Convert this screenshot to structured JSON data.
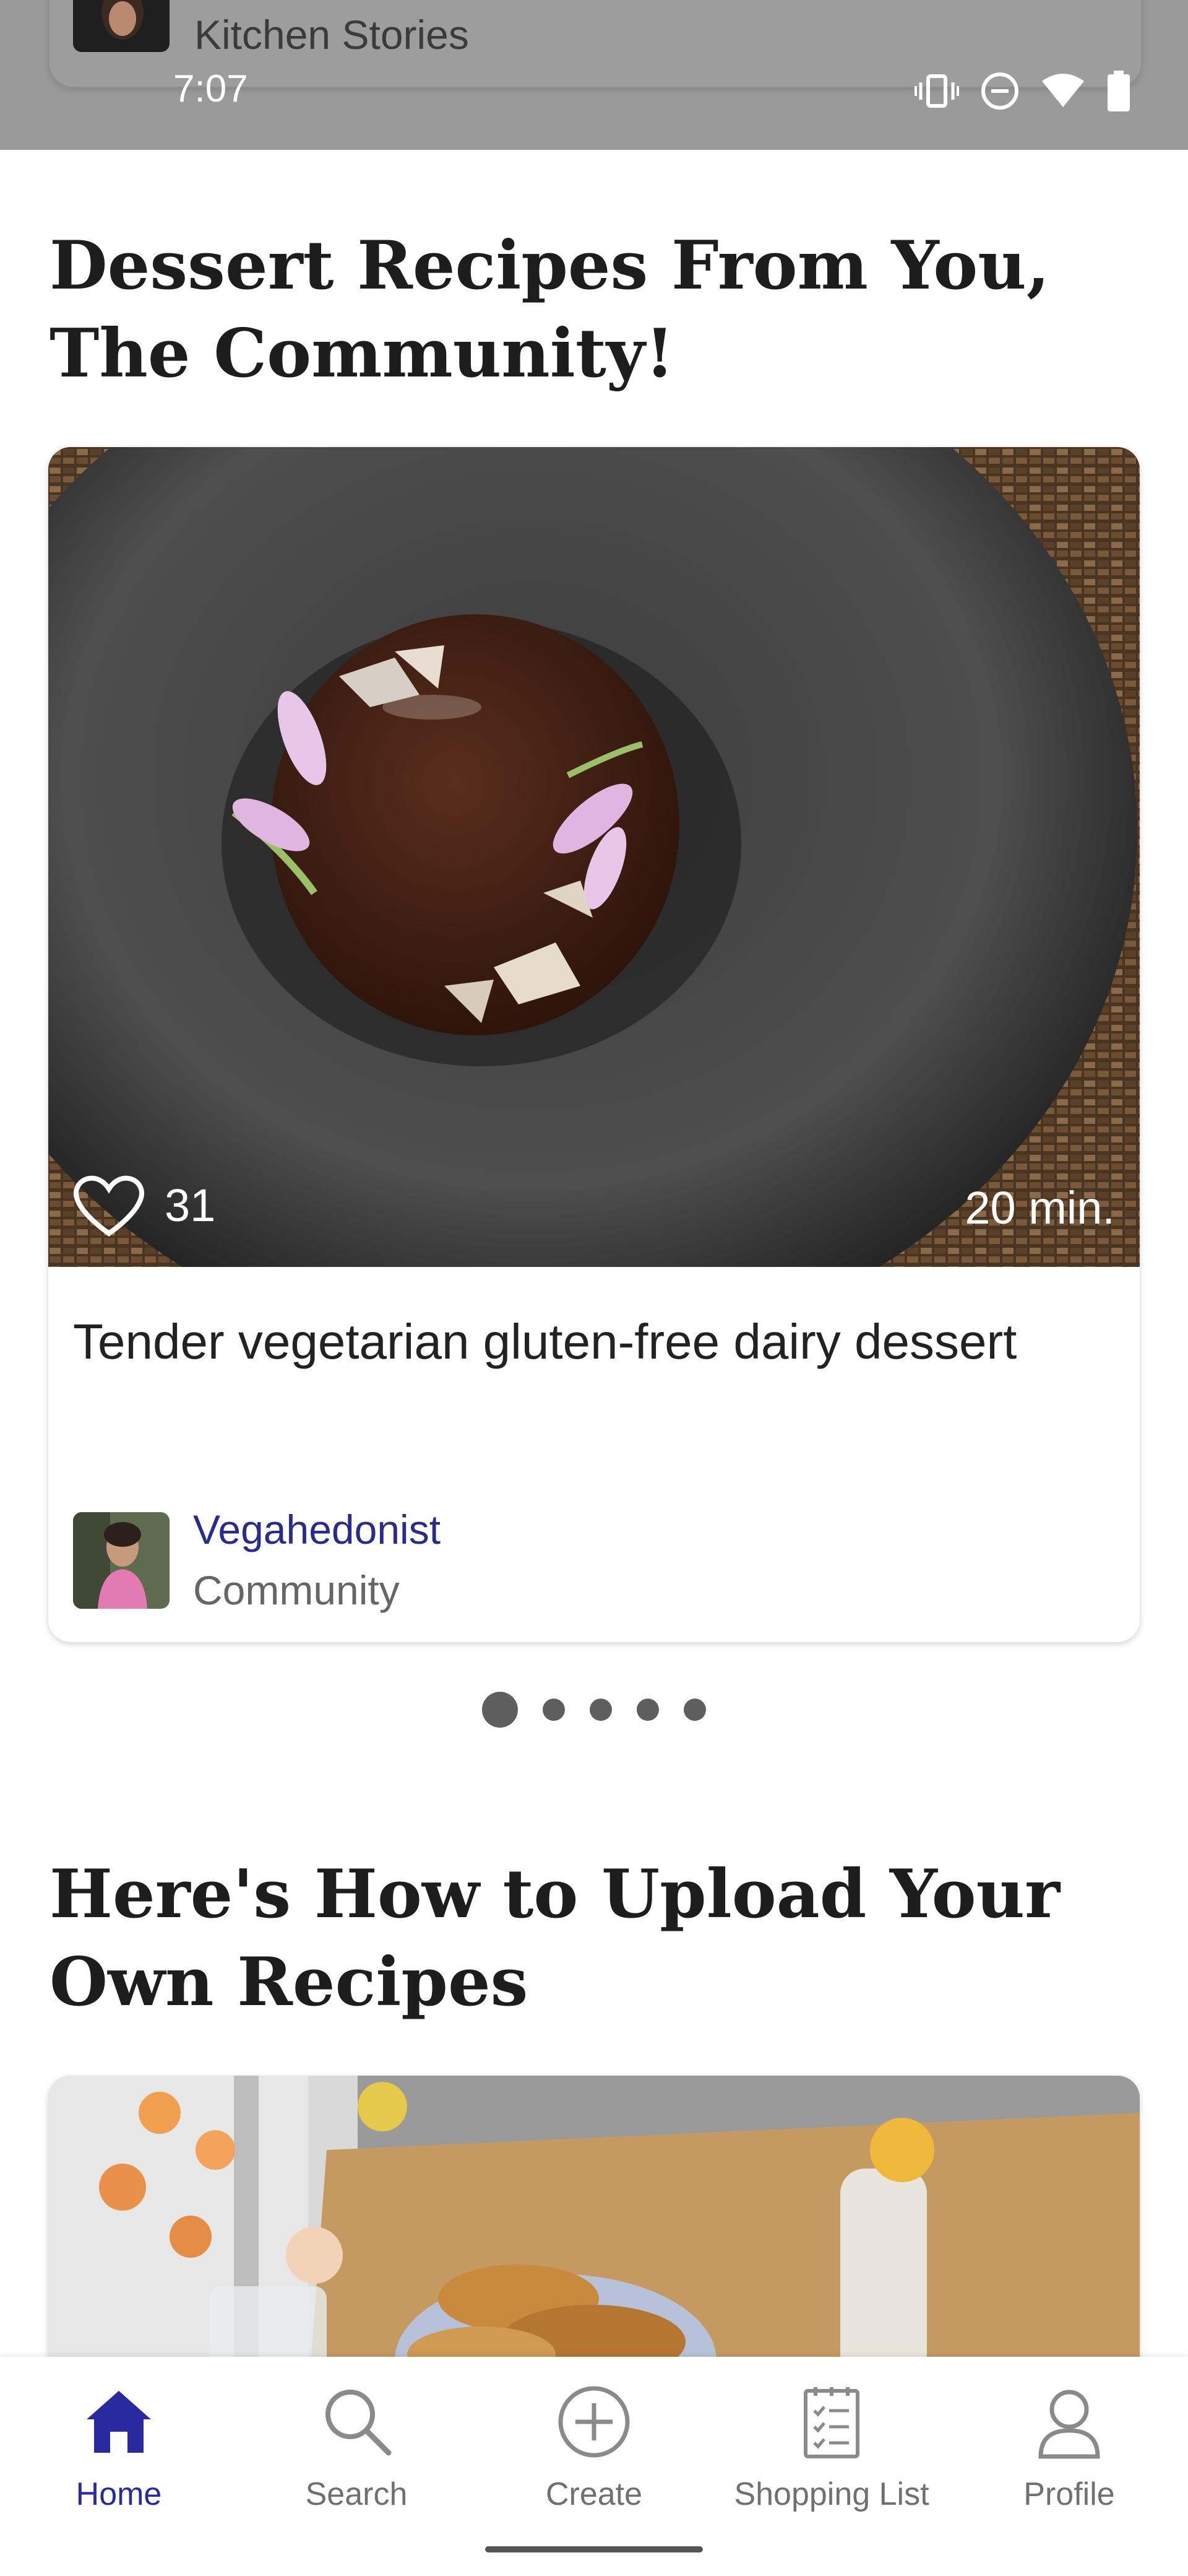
{
  "status_bar": {
    "time": "7:07",
    "notification_title": "Kitchen Stories",
    "icons": [
      "vibrate-icon",
      "do-not-disturb-icon",
      "wifi-icon",
      "battery-icon"
    ]
  },
  "sections": [
    {
      "title": "Dessert Recipes From You, The Community!",
      "card": {
        "likes": "31",
        "duration": "20 min.",
        "title": "Tender vegetarian gluten-free dairy dessert",
        "author_name": "Vegahedonist",
        "author_type": "Community"
      },
      "carousel": {
        "count": 5,
        "active": 0
      }
    },
    {
      "title": "Here's How to Upload Your Own Recipes"
    }
  ],
  "bottom_nav": {
    "items": [
      {
        "label": "Home",
        "icon": "home-icon",
        "active": true
      },
      {
        "label": "Search",
        "icon": "search-icon",
        "active": false
      },
      {
        "label": "Create",
        "icon": "plus-circle-icon",
        "active": false
      },
      {
        "label": "Shopping List",
        "icon": "shopping-list-icon",
        "active": false
      },
      {
        "label": "Profile",
        "icon": "profile-icon",
        "active": false
      }
    ]
  },
  "colors": {
    "accent": "#2a2aa0",
    "inactive": "#707070",
    "author_link": "#2b2b8a"
  }
}
